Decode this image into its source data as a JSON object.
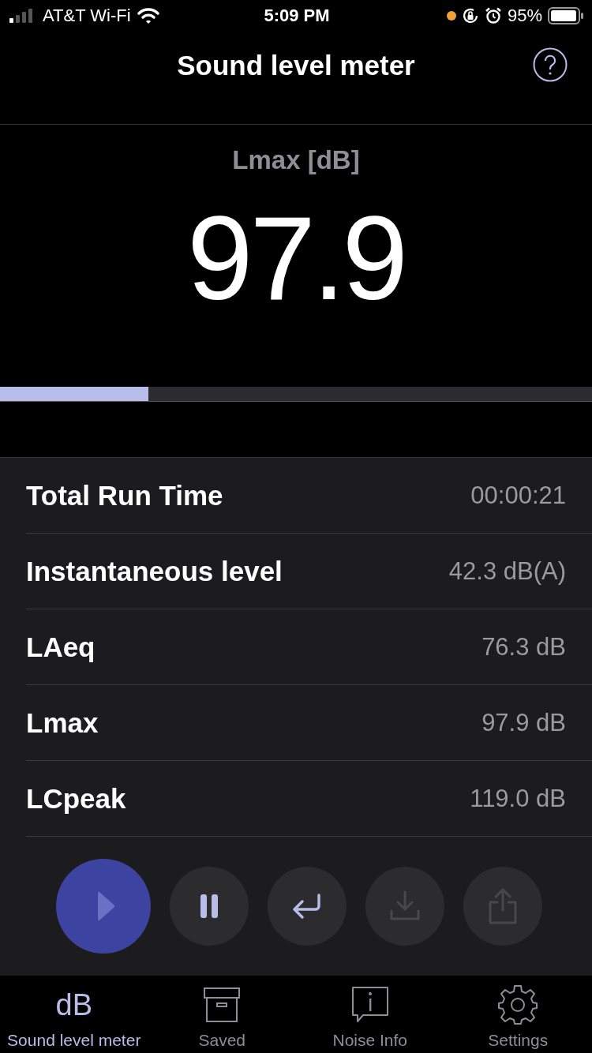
{
  "status_bar": {
    "carrier": "AT&T Wi-Fi",
    "time": "5:09 PM",
    "battery": "95%"
  },
  "nav": {
    "title": "Sound level meter"
  },
  "meter": {
    "label": "Lmax [dB]",
    "value": "97.9",
    "level": 0.25
  },
  "stats": [
    {
      "label": "Total Run Time",
      "value": "00:00:21"
    },
    {
      "label": "Instantaneous level",
      "value": "42.3 dB(A)"
    },
    {
      "label": "LAeq",
      "value": "76.3 dB"
    },
    {
      "label": "Lmax",
      "value": "97.9 dB"
    },
    {
      "label": "LCpeak",
      "value": "119.0 dB"
    }
  ],
  "controls": [
    {
      "kind": "play",
      "disabled": false
    },
    {
      "kind": "pause",
      "disabled": false
    },
    {
      "kind": "reset",
      "disabled": false
    },
    {
      "kind": "download",
      "disabled": true
    },
    {
      "kind": "share",
      "disabled": true
    }
  ],
  "tabs": [
    {
      "kind": "db",
      "icon_text": "dB",
      "label": "Sound level meter",
      "selected": true
    },
    {
      "kind": "saved",
      "label": "Saved",
      "selected": false
    },
    {
      "kind": "info",
      "label": "Noise Info",
      "selected": false
    },
    {
      "kind": "settings",
      "label": "Settings",
      "selected": false
    }
  ]
}
